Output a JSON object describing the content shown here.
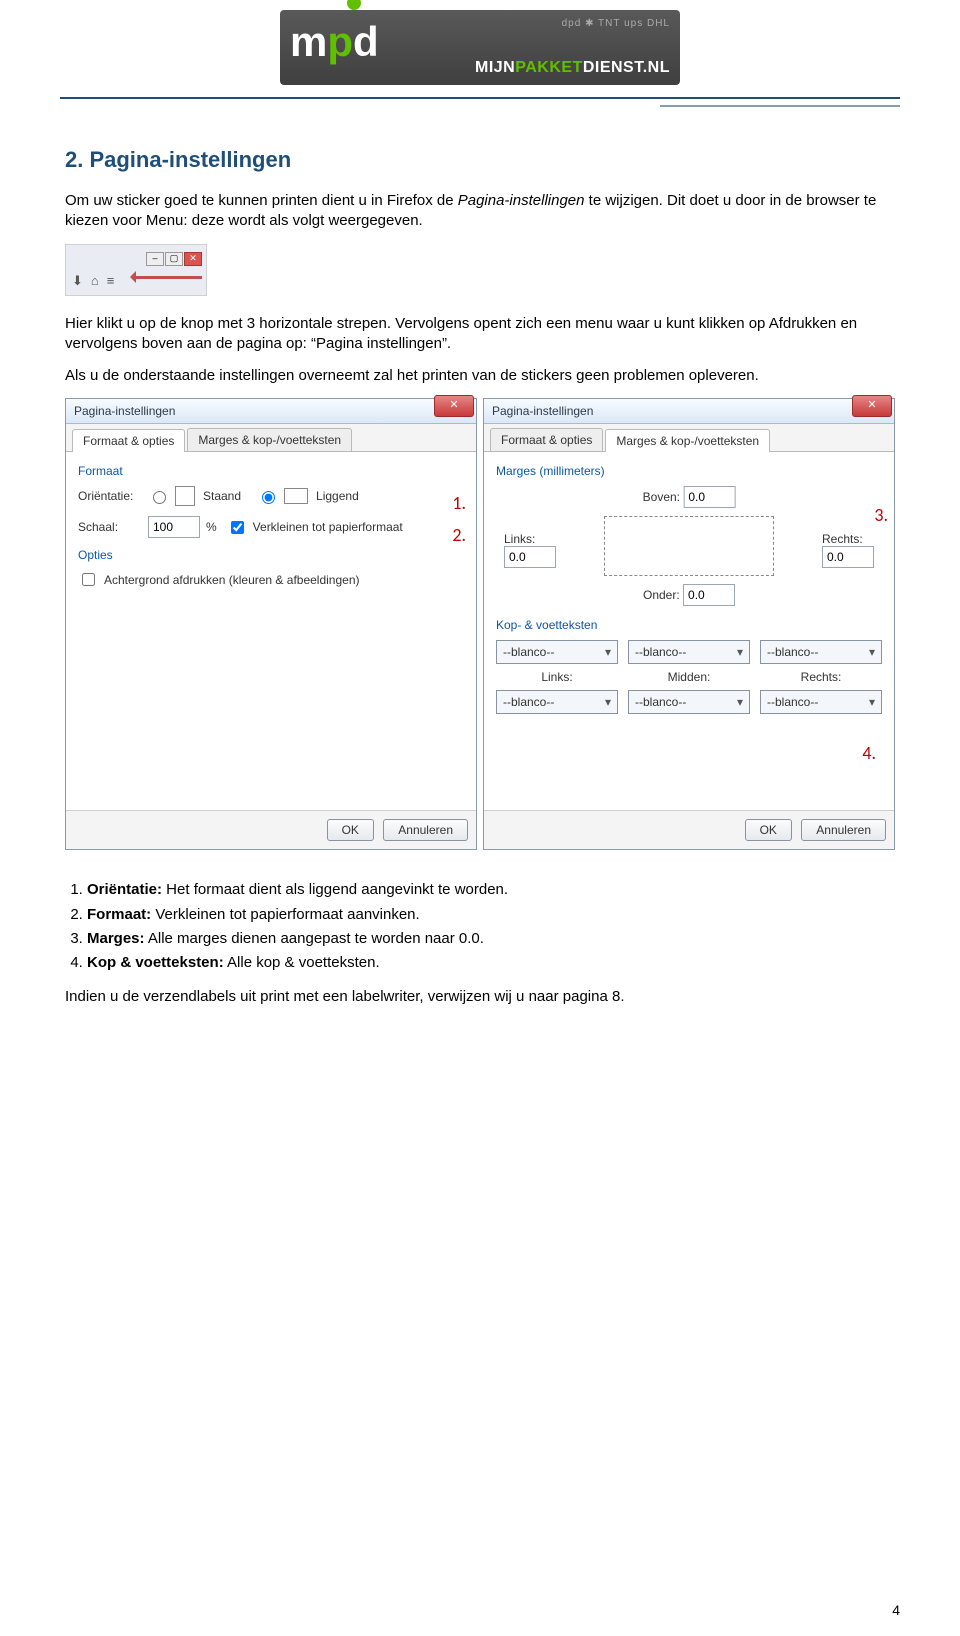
{
  "logo": {
    "brand_line1": "mp",
    "brand_line2": "MIJNPAKKETDIENST.NL",
    "carriers": "dpd  ✱  TNT  ups  DHL"
  },
  "section": {
    "title": "2. Pagina-instellingen",
    "p1a": "Om uw sticker goed te kunnen printen dient u in Firefox de ",
    "p1b": "Pagina-instellingen",
    "p1c": " te wijzigen. Dit doet u door in de browser te kiezen voor Menu: deze wordt als volgt weergegeven.",
    "p2": "Hier klikt u op de knop met 3  horizontale strepen. Vervolgens opent zich een menu waar u kunt klikken op Afdrukken en vervolgens boven aan de pagina op:  “Pagina instellingen”.",
    "p3": "Als u de onderstaande instellingen overneemt zal het printen van de stickers geen problemen opleveren.",
    "p4": "Indien u de verzendlabels uit print met een labelwriter, verwijzen wij u naar pagina 8."
  },
  "dlg": {
    "title": "Pagina-instellingen",
    "tab_format": "Formaat & opties",
    "tab_marges": "Marges & kop-/voetteksten",
    "grp_formaat": "Formaat",
    "lbl_orientatie": "Oriëntatie:",
    "lbl_staand": "Staand",
    "lbl_liggend": "Liggend",
    "lbl_schaal": "Schaal:",
    "val_schaal": "100",
    "pct": "%",
    "chk_verkleinen": "Verkleinen tot papierformaat",
    "grp_opties": "Opties",
    "chk_achtergrond": "Achtergrond afdrukken (kleuren & afbeeldingen)",
    "grp_marges": "Marges (millimeters)",
    "lbl_boven": "Boven:",
    "lbl_onder": "Onder:",
    "lbl_links": "Links:",
    "lbl_rechts": "Rechts:",
    "val_zero": "0.0",
    "grp_hf": "Kop- & voetteksten",
    "dd_blank": "--blanco--",
    "hf_links": "Links:",
    "hf_midden": "Midden:",
    "hf_rechts": "Rechts:",
    "btn_ok": "OK",
    "btn_cancel": "Annuleren",
    "an1": "1.",
    "an2": "2.",
    "an3": "3.",
    "an4": "4."
  },
  "steps": {
    "s1b": "Oriëntatie:",
    "s1": " Het formaat dient als liggend aangevinkt te worden.",
    "s2b": "Formaat:",
    "s2": " Verkleinen tot papierformaat aanvinken.",
    "s3b": "Marges:",
    "s3": " Alle marges dienen aangepast te worden naar 0.0.",
    "s4b": "Kop & voetteksten:",
    "s4": " Alle kop & voetteksten."
  },
  "page_number": "4"
}
